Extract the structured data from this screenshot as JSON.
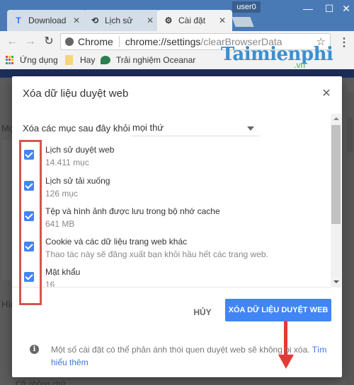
{
  "window": {
    "user_badge": "user0",
    "minimize_icon": "—",
    "maximize_icon": "☐",
    "close_icon": "✕"
  },
  "tabs": [
    {
      "label": "Download",
      "icon": "T",
      "close": "✕",
      "active": false
    },
    {
      "label": "Lịch sử",
      "icon": "⟲",
      "close": "✕",
      "active": false
    },
    {
      "label": "Cài đặt",
      "icon": "⚙",
      "close": "✕",
      "active": true
    }
  ],
  "toolbar": {
    "back_icon": "←",
    "forward_icon": "→",
    "reload_icon": "↻",
    "site_name": "Chrome",
    "url_host": "chrome://settings",
    "url_path": "/clearBrowserData",
    "star_icon": "☆",
    "menu_icon": "⋮"
  },
  "bookmarks": [
    {
      "label": "Ứng dụng",
      "icon": "apps-grid"
    },
    {
      "label": "Hay",
      "icon": "folder"
    },
    {
      "label": "Trải nghiệm Oceanar",
      "icon": "ocean"
    }
  ],
  "watermark": {
    "text": "Taimienphi",
    "suffix": ".vn"
  },
  "background_page": {
    "label_1": "Mọ",
    "label_2": "Hìn",
    "label_3": "Cỡ phông chữ"
  },
  "dialog": {
    "title": "Xóa dữ liệu duyệt web",
    "close_icon": "✕",
    "period_label": "Xóa các mục sau đây khỏi",
    "period_value": "mọi thứ",
    "items": [
      {
        "title": "Lịch sử duyệt web",
        "subtitle": "14.411 mục",
        "checked": true
      },
      {
        "title": "Lịch sử tải xuống",
        "subtitle": "126 mục",
        "checked": true
      },
      {
        "title": "Tệp và hình ảnh được lưu trong bộ nhớ cache",
        "subtitle": "641 MB",
        "checked": true
      },
      {
        "title": "Cookie và các dữ liệu trang web khác",
        "subtitle": "Thao tác này sẽ đăng xuất bạn khỏi hầu hết các trang web.",
        "checked": true
      },
      {
        "title": "Mật khẩu",
        "subtitle": "16",
        "checked": true
      }
    ],
    "cancel_label": "HỦY",
    "clear_label": "XÓA DỮ LIỆU DUYỆT WEB",
    "info_icon": "i",
    "note_text": "Một số cài đặt có thể phản ánh thói quen duyệt web sẽ không bị xóa.",
    "note_link": "Tìm hiểu thêm"
  },
  "colors": {
    "accent": "#4285f4",
    "highlight_box": "#d9534f",
    "arrow": "#e53935",
    "titlebar": "#4a7ab5"
  }
}
